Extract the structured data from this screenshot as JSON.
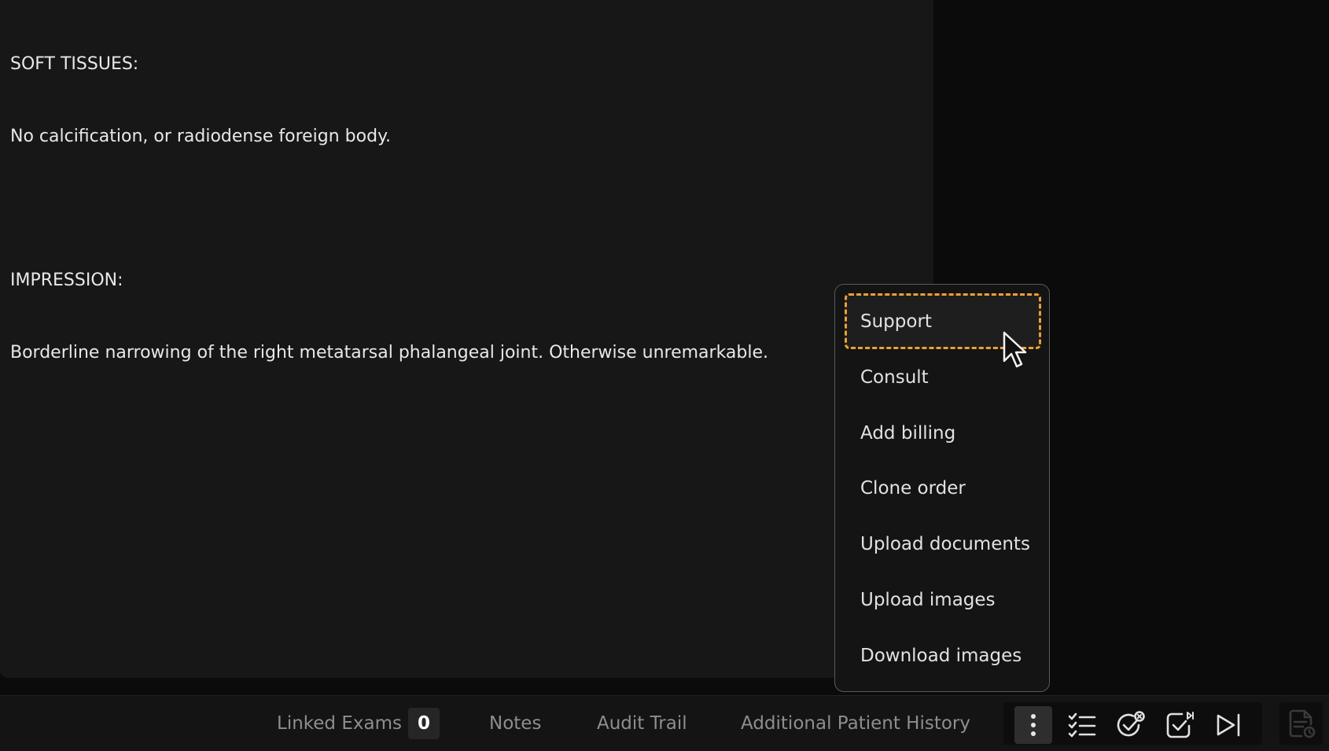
{
  "report": {
    "soft_tissues_heading": "SOFT TISSUES:",
    "soft_tissues_text": "No calcification, or radiodense foreign body.",
    "impression_heading": "IMPRESSION:",
    "impression_text": "Borderline narrowing of the right metatarsal phalangeal joint. Otherwise unremarkable."
  },
  "menu": {
    "items": [
      {
        "label": "Support",
        "focused": true
      },
      {
        "label": "Consult"
      },
      {
        "label": "Add billing"
      },
      {
        "label": "Clone order"
      },
      {
        "label": "Upload documents"
      },
      {
        "label": "Upload images"
      },
      {
        "label": "Download images"
      }
    ]
  },
  "bottom_bar": {
    "tabs": {
      "linked_exams": "Linked Exams",
      "linked_exams_count": "0",
      "notes": "Notes",
      "audit_trail": "Audit Trail",
      "additional_history": "Additional Patient History"
    },
    "icons": [
      "more-vertical-icon",
      "checklist-icon",
      "check-cancel-icon",
      "check-next-icon",
      "skip-next-icon",
      "document-history-icon"
    ]
  },
  "colors": {
    "focus_outline": "#f0a030",
    "panel_bg": "#171717",
    "page_bg": "#0b0b0b"
  }
}
